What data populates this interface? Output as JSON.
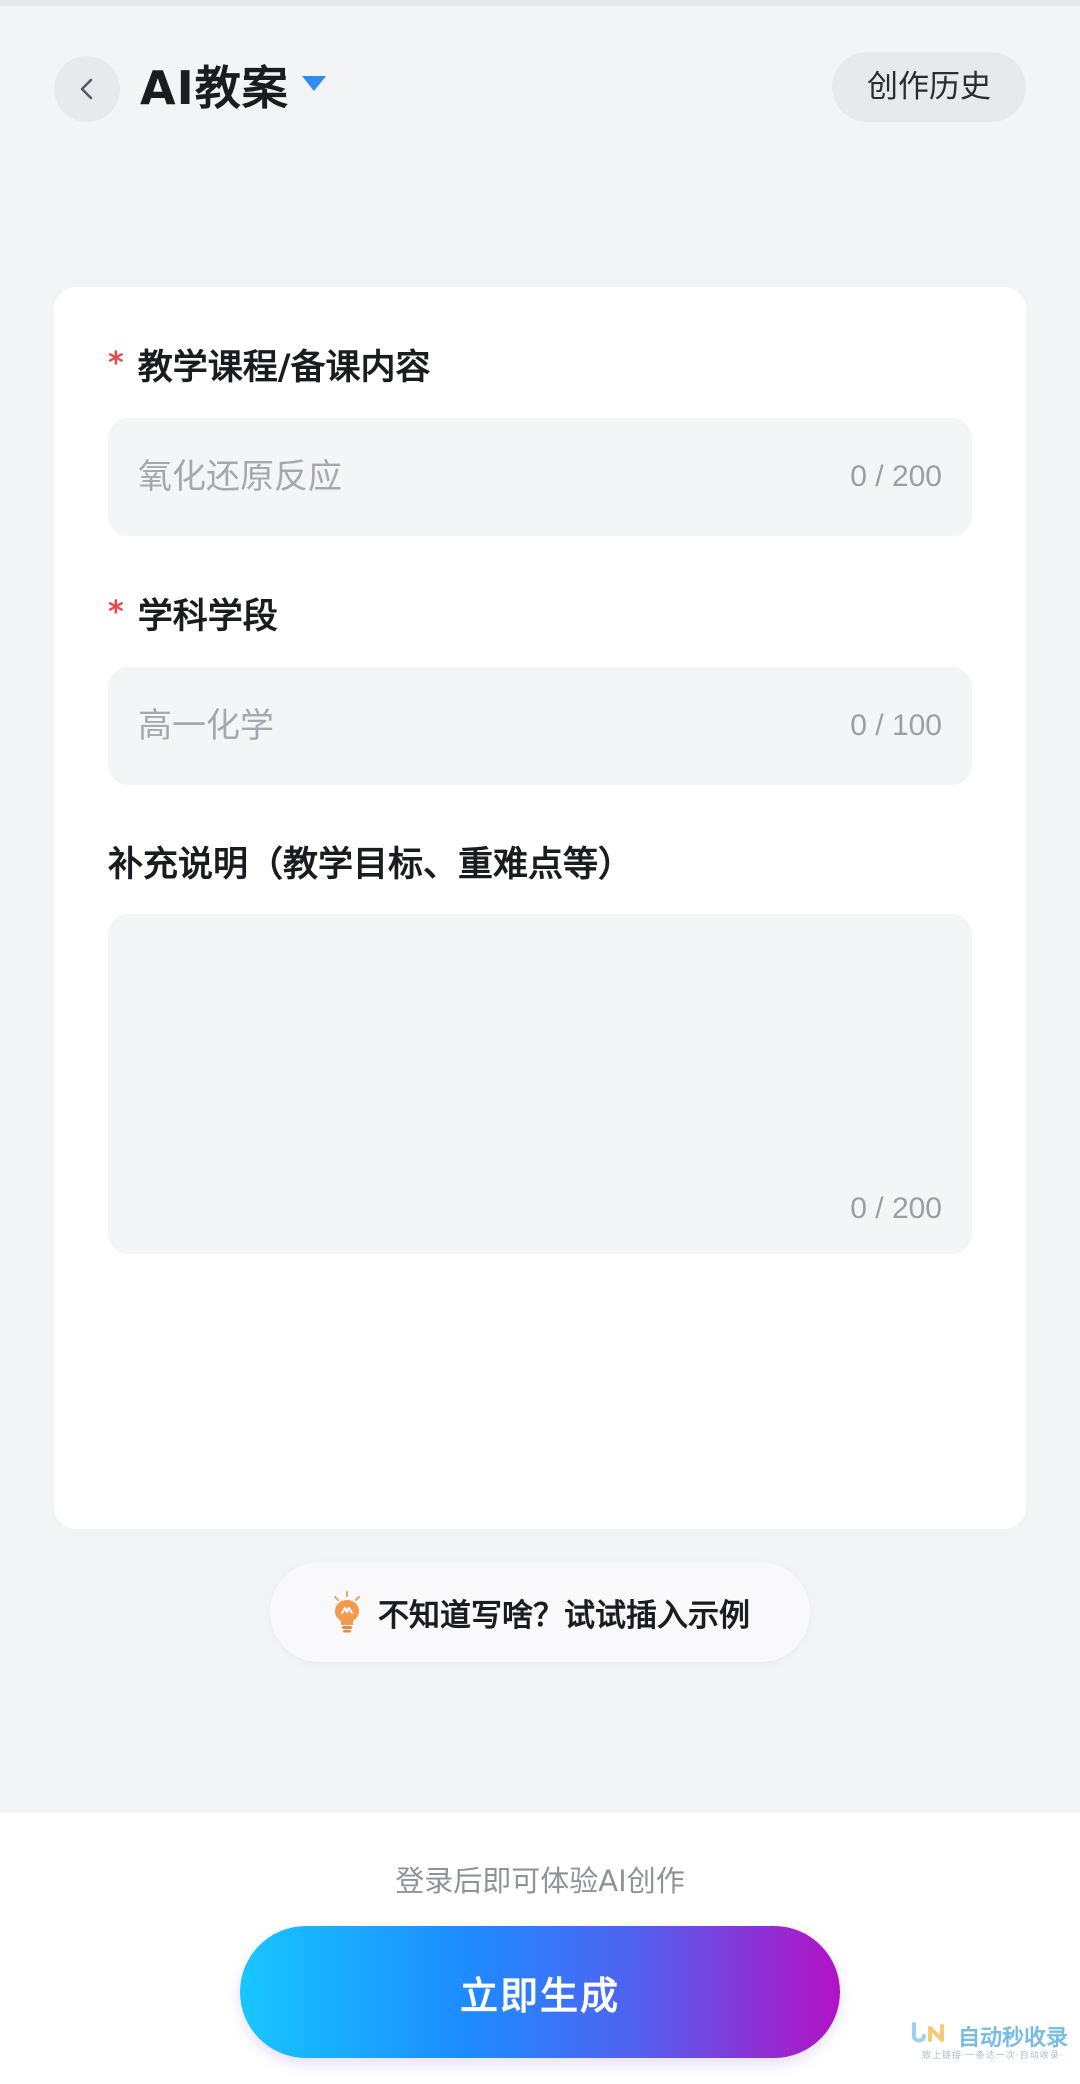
{
  "header": {
    "title": "AI教案",
    "history_button": "创作历史"
  },
  "form": {
    "fields": [
      {
        "label": "教学课程/备课内容",
        "required": true,
        "placeholder": "氧化还原反应",
        "counter": "0 / 200"
      },
      {
        "label": "学科学段",
        "required": true,
        "placeholder": "高一化学",
        "counter": "0 / 100"
      },
      {
        "label": "补充说明（教学目标、重难点等）",
        "required": false,
        "placeholder": "",
        "counter": "0 / 200"
      }
    ]
  },
  "example_button": {
    "label": "不知道写啥？试试插入示例",
    "icon": "lightbulb-icon"
  },
  "footer": {
    "login_hint": "登录后即可体验AI创作",
    "generate_button": "立即生成"
  },
  "watermark": {
    "text": "自动秒收录",
    "sub": "致上链接·一条达一次·自动收录·"
  },
  "colors": {
    "accent": "#2f8cf7",
    "required_star": "#e9474b",
    "gradient_start": "#17c6ff",
    "gradient_end": "#b312c4"
  }
}
